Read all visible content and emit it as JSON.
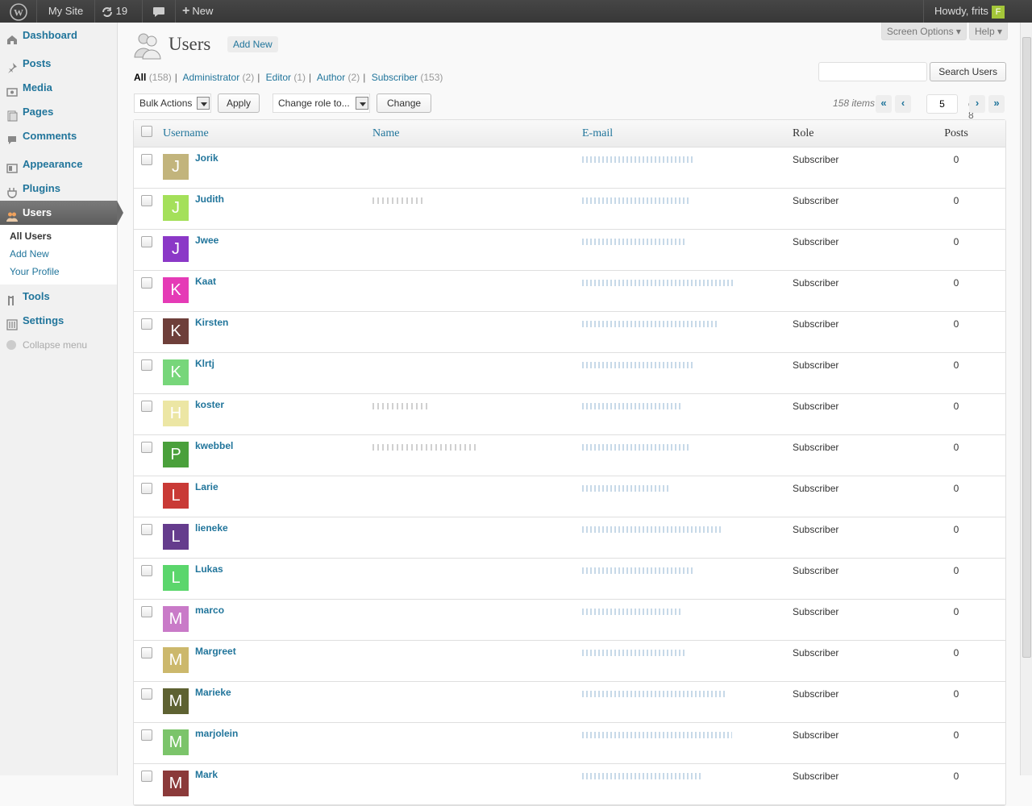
{
  "adminbar": {
    "site": "My Site",
    "updates": "19",
    "new": "New",
    "howdy": "Howdy, frits",
    "avatar_letter": "F"
  },
  "menu": {
    "items": [
      "Dashboard",
      "Posts",
      "Media",
      "Pages",
      "Comments",
      "Appearance",
      "Plugins",
      "Users",
      "Tools",
      "Settings"
    ],
    "submenu": [
      "All Users",
      "Add New",
      "Your Profile"
    ],
    "collapse": "Collapse menu"
  },
  "screen_options": "Screen Options",
  "help": "Help",
  "page": {
    "title": "Users",
    "add_new": "Add New"
  },
  "filters": [
    {
      "label": "All",
      "count": "(158)"
    },
    {
      "label": "Administrator",
      "count": "(2)"
    },
    {
      "label": "Editor",
      "count": "(1)"
    },
    {
      "label": "Author",
      "count": "(2)"
    },
    {
      "label": "Subscriber",
      "count": "(153)"
    }
  ],
  "search": {
    "button": "Search Users"
  },
  "bulk": {
    "select": "Bulk Actions",
    "apply": "Apply",
    "role_select": "Change role to...",
    "change": "Change"
  },
  "pagination": {
    "items": "158 items",
    "current": "5",
    "of": "of 8",
    "first": "«",
    "prev": "‹",
    "next": "›",
    "last": "»"
  },
  "columns": {
    "username": "Username",
    "name": "Name",
    "email": "E-mail",
    "role": "Role",
    "posts": "Posts"
  },
  "users": [
    {
      "letter": "J",
      "color": "#c2b47c",
      "username": "Jorik",
      "name_w": 0,
      "email_w": 140,
      "role": "Subscriber",
      "posts": "0"
    },
    {
      "letter": "J",
      "color": "#a4e05a",
      "username": "Judith",
      "name_w": 65,
      "email_w": 132,
      "role": "Subscriber",
      "posts": "0"
    },
    {
      "letter": "J",
      "color": "#8b38c7",
      "username": "Jwee",
      "name_w": 0,
      "email_w": 128,
      "role": "Subscriber",
      "posts": "0"
    },
    {
      "letter": "K",
      "color": "#e53bb6",
      "username": "Kaat",
      "name_w": 0,
      "email_w": 190,
      "role": "Subscriber",
      "posts": "0"
    },
    {
      "letter": "K",
      "color": "#6e3f3a",
      "username": "Kirsten",
      "name_w": 0,
      "email_w": 170,
      "role": "Subscriber",
      "posts": "0"
    },
    {
      "letter": "K",
      "color": "#77d67a",
      "username": "Klrtj",
      "name_w": 0,
      "email_w": 140,
      "role": "Subscriber",
      "posts": "0"
    },
    {
      "letter": "H",
      "color": "#ece6a4",
      "username": "koster",
      "name_w": 70,
      "email_w": 122,
      "role": "Subscriber",
      "posts": "0"
    },
    {
      "letter": "P",
      "color": "#4aa03b",
      "username": "kwebbel",
      "name_w": 130,
      "email_w": 135,
      "role": "Subscriber",
      "posts": "0"
    },
    {
      "letter": "L",
      "color": "#c93a36",
      "username": "Larie",
      "name_w": 0,
      "email_w": 108,
      "role": "Subscriber",
      "posts": "0"
    },
    {
      "letter": "L",
      "color": "#653c8d",
      "username": "lieneke",
      "name_w": 0,
      "email_w": 172,
      "role": "Subscriber",
      "posts": "0"
    },
    {
      "letter": "L",
      "color": "#5bd66c",
      "username": "Lukas",
      "name_w": 0,
      "email_w": 138,
      "role": "Subscriber",
      "posts": "0"
    },
    {
      "letter": "M",
      "color": "#c97ac8",
      "username": "marco",
      "name_w": 0,
      "email_w": 124,
      "role": "Subscriber",
      "posts": "0"
    },
    {
      "letter": "M",
      "color": "#ccb86c",
      "username": "Margreet",
      "name_w": 0,
      "email_w": 130,
      "role": "Subscriber",
      "posts": "0"
    },
    {
      "letter": "M",
      "color": "#5e6232",
      "username": "Marieke",
      "name_w": 0,
      "email_w": 180,
      "role": "Subscriber",
      "posts": "0"
    },
    {
      "letter": "M",
      "color": "#7bc46a",
      "username": "marjolein",
      "name_w": 0,
      "email_w": 186,
      "role": "Subscriber",
      "posts": "0"
    },
    {
      "letter": "M",
      "color": "#8b3a3a",
      "username": "Mark",
      "name_w": 0,
      "email_w": 150,
      "role": "Subscriber",
      "posts": "0"
    }
  ]
}
